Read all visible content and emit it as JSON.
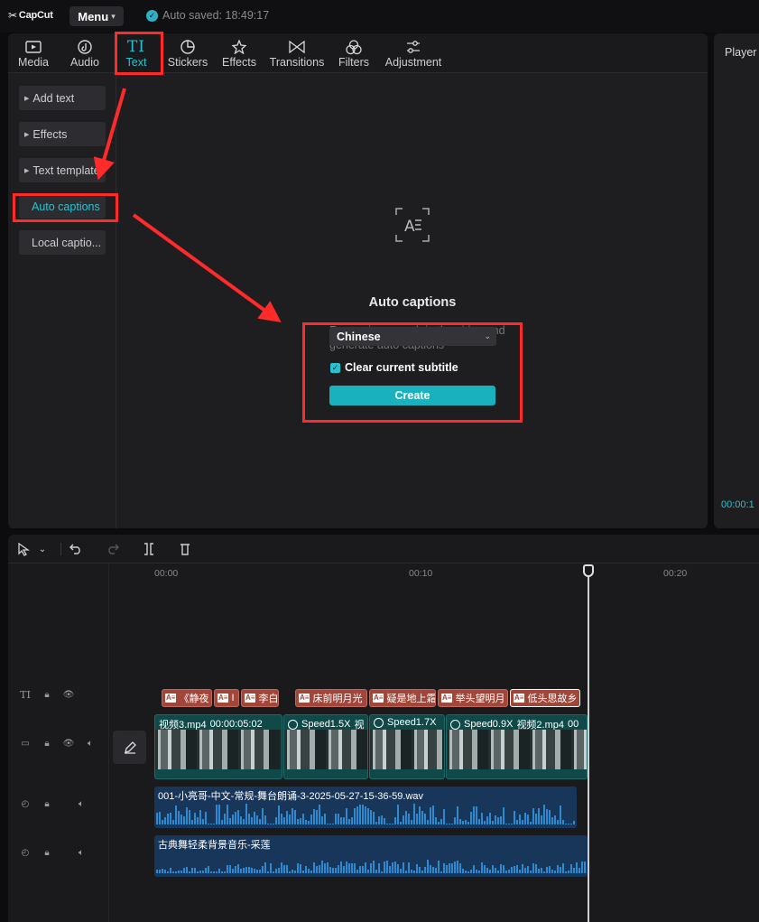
{
  "app": {
    "logo_text": "CapCut",
    "menu_label": "Menu",
    "autosave_text": "Auto saved: 18:49:17"
  },
  "toolbar": {
    "tabs": [
      {
        "label": "Media",
        "icon": "media-icon"
      },
      {
        "label": "Audio",
        "icon": "audio-icon"
      },
      {
        "label": "Text",
        "icon": "text-icon",
        "active": true
      },
      {
        "label": "Stickers",
        "icon": "sticker-icon"
      },
      {
        "label": "Effects",
        "icon": "effects-icon"
      },
      {
        "label": "Transitions",
        "icon": "transitions-icon"
      },
      {
        "label": "Filters",
        "icon": "filters-icon"
      },
      {
        "label": "Adjustment",
        "icon": "adjustment-icon"
      }
    ]
  },
  "sidebar": {
    "items": [
      {
        "label": "Add text"
      },
      {
        "label": "Effects"
      },
      {
        "label": "Text template"
      },
      {
        "label": "Auto captions",
        "active": true
      },
      {
        "label": "Local captio..."
      }
    ]
  },
  "auto_captions": {
    "title": "Auto captions",
    "description": "Recognize speech in the video and generate auto captions",
    "language": "Chinese",
    "clear_label": "Clear current subtitle",
    "clear_checked": true,
    "create_label": "Create"
  },
  "player": {
    "title": "Player",
    "time": "00:00:1"
  },
  "timeline": {
    "ruler": [
      "00:00",
      "00:10",
      "00:20"
    ],
    "text_clips": [
      "《静夜",
      "I",
      "李白",
      "床前明月光",
      "疑是地上霜",
      "举头望明月",
      "低头思故乡"
    ],
    "video_clips": [
      {
        "name": "视频3.mp4",
        "duration": "00:00:05:02"
      },
      {
        "speed": "Speed1.5X",
        "name": "视"
      },
      {
        "speed": "Speed1.7X",
        "name": ""
      },
      {
        "speed": "Speed0.9X",
        "name": "视频2.mp4",
        "extra": "00"
      }
    ],
    "audio_tracks": [
      {
        "name": "001-小亮哥-中文-常规-舞台朗诵-3-2025-05-27-15-36-59.wav"
      },
      {
        "name": "古典舞轻柔背景音乐-采莲"
      }
    ]
  },
  "colors": {
    "accent": "#27c2d1",
    "annotation": "#ff2a2a",
    "text_clip": "#a2463a",
    "video_clip": "#0f4a49",
    "audio_clip": "#17365a"
  }
}
